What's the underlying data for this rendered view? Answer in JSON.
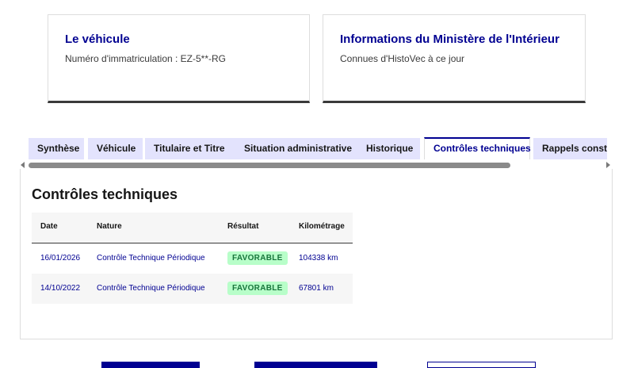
{
  "cards": {
    "vehicle": {
      "title": "Le véhicule",
      "description": "Numéro d'immatriculation : EZ-5**-RG"
    },
    "ministry": {
      "title": "Informations du Ministère de l'Intérieur",
      "description": "Connues d'HistoVec à ce jour"
    }
  },
  "tabs": [
    {
      "label": "Synthèse"
    },
    {
      "label": "Véhicule"
    },
    {
      "label": "Titulaire et Titre"
    },
    {
      "label": "Situation administrative"
    },
    {
      "label": "Historique"
    },
    {
      "label": "Contrôles techniques",
      "active": true
    },
    {
      "label": "Rappels constructeur"
    }
  ],
  "panel": {
    "title": "Contrôles techniques",
    "headers": {
      "date": "Date",
      "nature": "Nature",
      "result": "Résultat",
      "mileage": "Kilométrage"
    },
    "rows": [
      {
        "date": "16/01/2026",
        "nature": "Contrôle Technique Périodique",
        "result": "FAVORABLE",
        "mileage": "104338 km"
      },
      {
        "date": "14/10/2022",
        "nature": "Contrôle Technique Périodique",
        "result": "FAVORABLE",
        "mileage": "67801 km"
      }
    ]
  },
  "colors": {
    "primary": "#000091",
    "tab_bg": "#e3e3fd",
    "badge_bg": "#b8fec9",
    "badge_text": "#18753c"
  },
  "icons": {
    "scroll_left": "triangle-left-icon",
    "scroll_right": "triangle-right-icon"
  }
}
